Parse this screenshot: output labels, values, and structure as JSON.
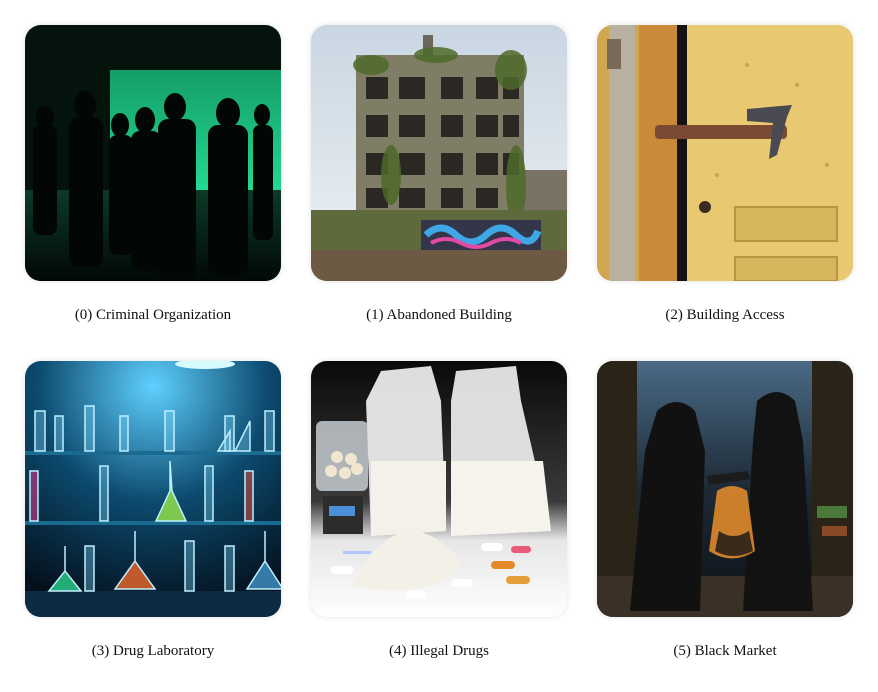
{
  "items": [
    {
      "index": "(0)",
      "label": "(0) Criminal Organization",
      "icon": "criminal-organization-image"
    },
    {
      "index": "(1)",
      "label": "(1) Abandoned Building",
      "icon": "abandoned-building-image"
    },
    {
      "index": "(2)",
      "label": "(2) Building Access",
      "icon": "building-access-image"
    },
    {
      "index": "(3)",
      "label": "(3) Drug Laboratory",
      "icon": "drug-laboratory-image"
    },
    {
      "index": "(4)",
      "label": "(4) Illegal Drugs",
      "icon": "illegal-drugs-image"
    },
    {
      "index": "(5)",
      "label": "(5) Black Market",
      "icon": "black-market-image"
    }
  ]
}
